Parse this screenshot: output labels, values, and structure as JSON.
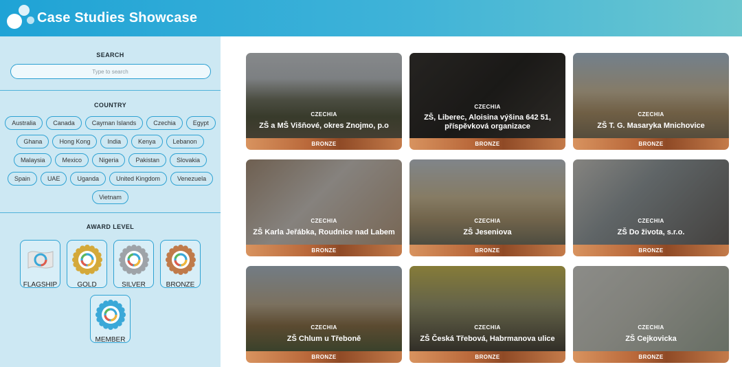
{
  "header": {
    "title": "Case Studies Showcase"
  },
  "sidebar": {
    "search_title": "SEARCH",
    "search_placeholder": "Type to search",
    "country_title": "COUNTRY",
    "countries": [
      "Australia",
      "Canada",
      "Cayman Islands",
      "Czechia",
      "Egypt",
      "Ghana",
      "Hong Kong",
      "India",
      "Kenya",
      "Lebanon",
      "Malaysia",
      "Mexico",
      "Nigeria",
      "Pakistan",
      "Slovakia",
      "Spain",
      "UAE",
      "Uganda",
      "United Kingdom",
      "Venezuela",
      "Vietnam"
    ],
    "award_title": "AWARD LEVEL",
    "awards": [
      {
        "label": "FLAGSHIP",
        "color": "#d9d9d9"
      },
      {
        "label": "GOLD",
        "color": "#d4a93a"
      },
      {
        "label": "SILVER",
        "color": "#9ea3a8"
      },
      {
        "label": "BRONZE",
        "color": "#c07a4a"
      },
      {
        "label": "MEMBER",
        "color": "#3aa8d8"
      }
    ]
  },
  "cards": [
    {
      "country": "CZECHIA",
      "name": "ZŠ a MŠ Višňové, okres Znojmo, p.o",
      "award": "BRONZE"
    },
    {
      "country": "CZECHIA",
      "name": "ZŠ, Liberec, Aloisina výšina 642 51, příspěvková organizace",
      "award": "BRONZE"
    },
    {
      "country": "CZECHIA",
      "name": "ZŠ T. G. Masaryka Mnichovice",
      "award": "BRONZE"
    },
    {
      "country": "CZECHIA",
      "name": "ZŠ Karla Jeřábka, Roudnice nad Labem",
      "award": "BRONZE"
    },
    {
      "country": "CZECHIA",
      "name": "ZŠ Jeseniova",
      "award": "BRONZE"
    },
    {
      "country": "CZECHIA",
      "name": "ZŠ Do života, s.r.o.",
      "award": "BRONZE"
    },
    {
      "country": "CZECHIA",
      "name": "ZŠ Chlum u Třeboně",
      "award": "BRONZE"
    },
    {
      "country": "CZECHIA",
      "name": "ZŠ Česká Třebová, Habrmanova ulice",
      "award": "BRONZE"
    },
    {
      "country": "CZECHIA",
      "name": "ZŠ Cejkovicka",
      "award": "BRONZE"
    }
  ]
}
